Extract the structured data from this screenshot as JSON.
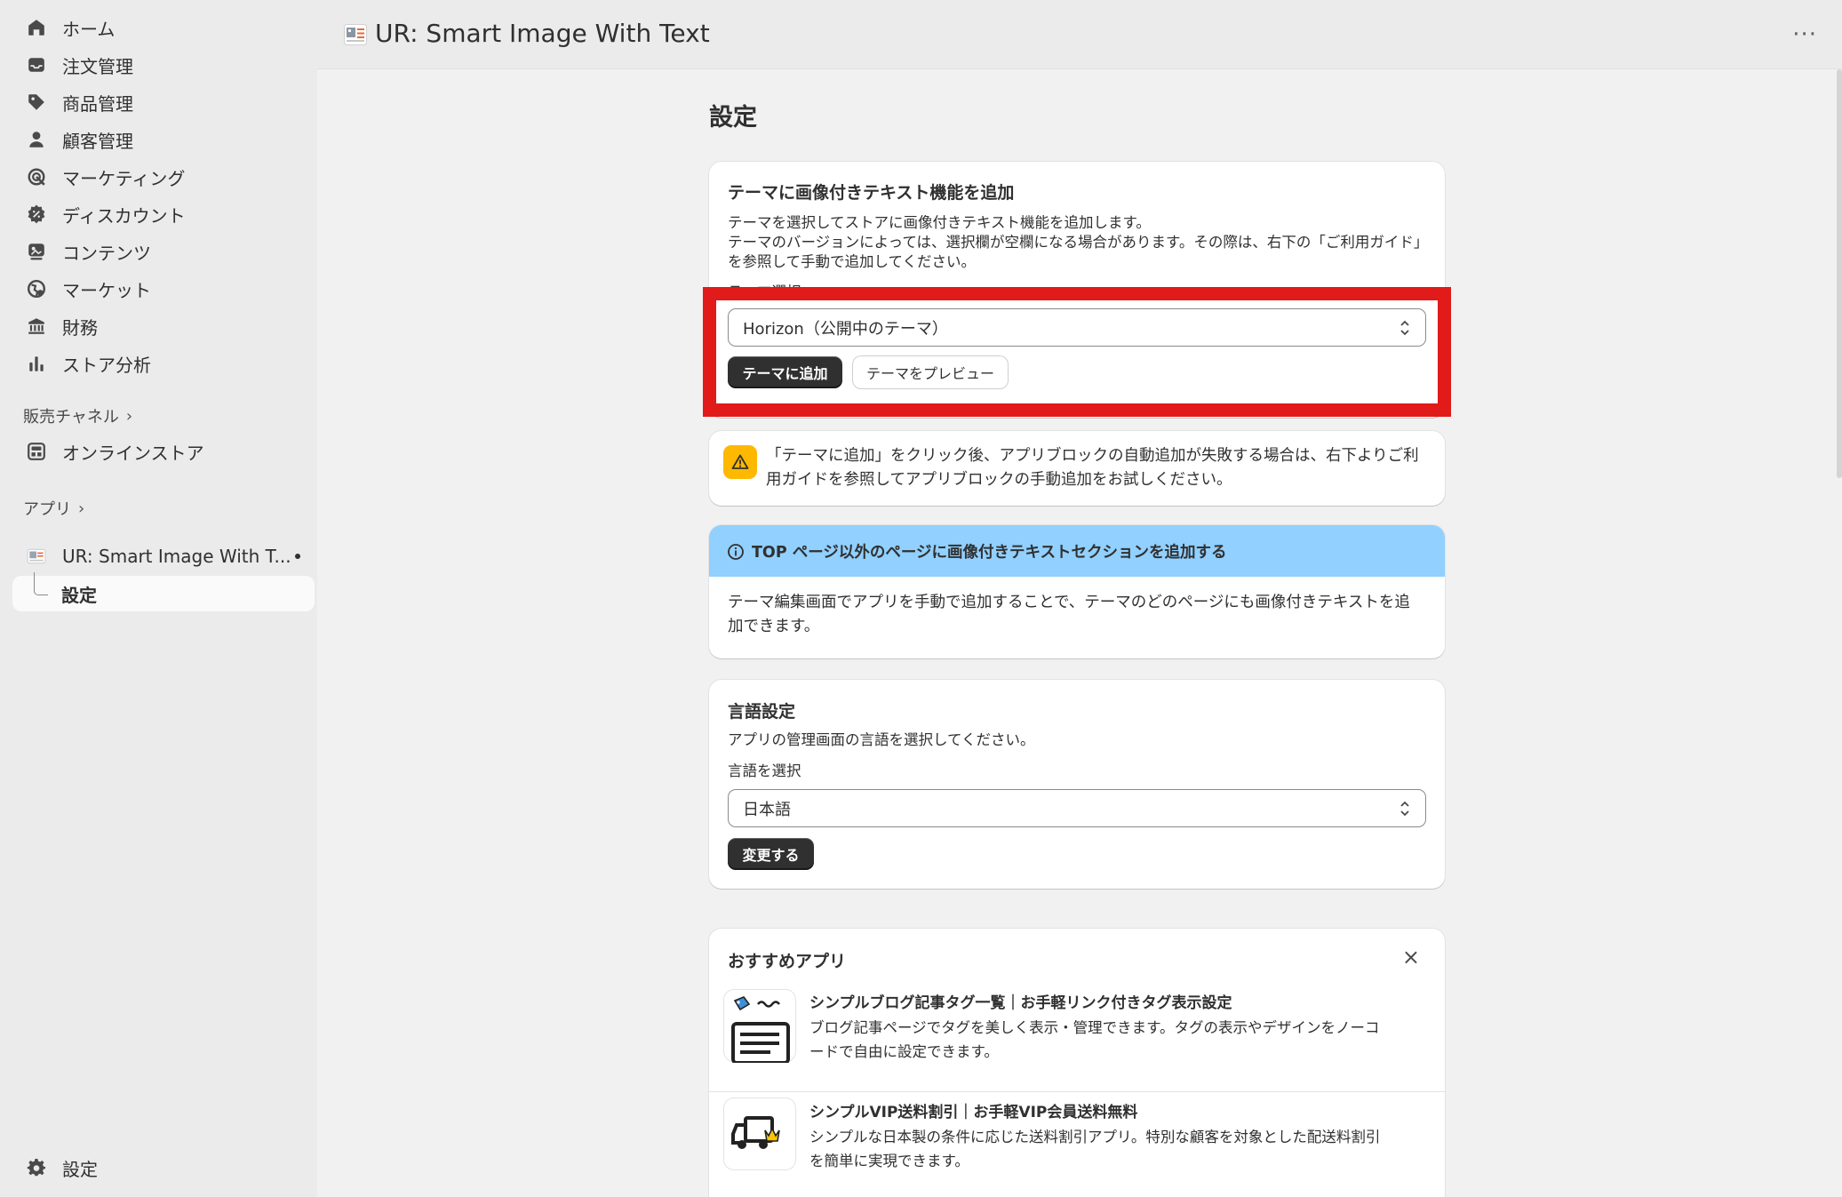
{
  "sidebar": {
    "items": [
      {
        "label": "ホーム",
        "icon": "home-icon"
      },
      {
        "label": "注文管理",
        "icon": "inbox-icon"
      },
      {
        "label": "商品管理",
        "icon": "tag-icon"
      },
      {
        "label": "顧客管理",
        "icon": "person-icon"
      },
      {
        "label": "マーケティング",
        "icon": "target-icon"
      },
      {
        "label": "ディスカウント",
        "icon": "discount-icon"
      },
      {
        "label": "コンテンツ",
        "icon": "content-icon"
      },
      {
        "label": "マーケット",
        "icon": "globe-icon"
      },
      {
        "label": "財務",
        "icon": "bank-icon"
      },
      {
        "label": "ストア分析",
        "icon": "chart-bars-icon"
      }
    ],
    "sales_channels_label": "販売チャネル",
    "online_store_label": "オンラインストア",
    "apps_label": "アプリ",
    "app_name": "UR: Smart Image With T...",
    "app_sub_item": "設定",
    "settings_label": "設定"
  },
  "topbar": {
    "title": "UR: Smart Image With Text",
    "more": "···"
  },
  "main": {
    "heading": "設定",
    "theme_card": {
      "title": "テーマに画像付きテキスト機能を追加",
      "desc_line1": "テーマを選択してストアに画像付きテキスト機能を追加します。",
      "desc_line2": "テーマのバージョンによっては、選択欄が空欄になる場合があります。その際は、右下の「ご利用ガイド」",
      "desc_line3": "を参照して手動で追加してください。",
      "select_label": "テーマ選択",
      "select_value": "Horizon（公開中のテーマ）",
      "add_button": "テーマに追加",
      "preview_button": "テーマをプレビュー"
    },
    "warning": {
      "line1": "「テーマに追加」をクリック後、アプリブロックの自動追加が失敗する場合は、右下よりご利",
      "line2": "用ガイドを参照してアプリブロックの手動追加をお試しください。"
    },
    "info_card": {
      "title": "TOP ページ以外のページに画像付きテキストセクションを追加する",
      "line1": "テーマ編集画面でアプリを手動で追加することで、テーマのどのページにも画像付きテキストを追",
      "line2": "加できます。"
    },
    "language_card": {
      "title": "言語設定",
      "desc": "アプリの管理画面の言語を選択してください。",
      "select_label": "言語を選択",
      "select_value": "日本語",
      "change_button": "変更する"
    },
    "recommended": {
      "title": "おすすめアプリ",
      "close": "×",
      "apps": [
        {
          "title": "シンプルブログ記事タグ一覧｜お手軽リンク付きタグ表示設定",
          "line1": "ブログ記事ページでタグを美しく表示・管理できます。タグの表示やデザインをノーコ",
          "line2": "ードで自由に設定できます。"
        },
        {
          "title": "シンプルVIP送料割引｜お手軽VIP会員送料無料",
          "line1": "シンプルな日本製の条件に応じた送料割引アプリ。特別な顧客を対象とした配送料割引",
          "line2": "を簡単に実現できます。"
        }
      ]
    }
  },
  "colors": {
    "highlight": "#e11a1a",
    "primary_button": "#303030",
    "warning_icon_bg": "#ffb800",
    "info_header_bg": "#91d0ff"
  }
}
